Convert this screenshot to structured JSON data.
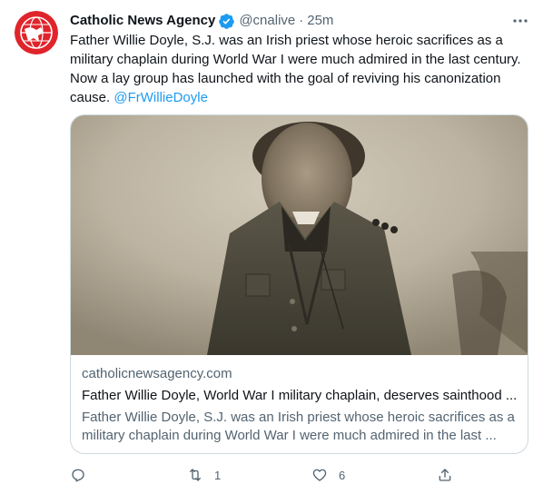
{
  "author": {
    "name": "Catholic News Agency",
    "handle": "@cnalive",
    "separator": "·",
    "time": "25m",
    "avatar_icon": "cna-logo-icon",
    "verified_icon": "verified-badge-icon"
  },
  "tweet": {
    "lines": [
      "Father Willie Doyle, S.J. was an Irish priest whose heroic sacrifices as a",
      "military chaplain during World War I were much admired in the last century.",
      "Now a lay group has launched with the goal of reviving his canonization"
    ],
    "last_line": "cause.",
    "mention": "@FrWillieDoyle"
  },
  "card": {
    "domain": "catholicnewsagency.com",
    "title": "Father Willie Doyle, World War I military chaplain, deserves sainthood ...",
    "description_lines": [
      "Father Willie Doyle, S.J. was an Irish priest whose heroic sacrifices as a",
      "military chaplain during World War I were much admired in the last ..."
    ]
  },
  "actions": {
    "reply_count": "",
    "retweet_count": "1",
    "like_count": "6"
  },
  "colors": {
    "accent": "#1d9bf0",
    "secondary_text": "#536471",
    "brand_red": "#e0242b"
  }
}
